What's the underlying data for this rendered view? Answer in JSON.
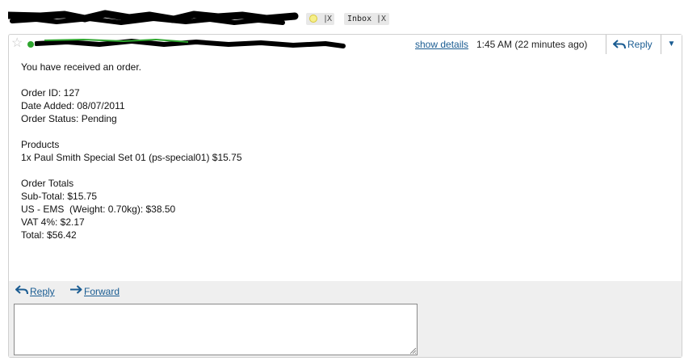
{
  "labels": {
    "d_remove": "X",
    "inbox": "Inbox",
    "inbox_remove": "X"
  },
  "header": {
    "show_details": "show details",
    "time": "1:45 AM (22 minutes ago)",
    "reply_label": "Reply",
    "more_icon": "▼"
  },
  "body": {
    "lines": [
      "You have received an order.",
      "",
      "Order ID: 127",
      "Date Added: 08/07/2011",
      "Order Status: Pending",
      "",
      "Products",
      "1x Paul Smith Special Set 01 (ps-special01) $15.75",
      "",
      "Order Totals",
      "Sub-Total: $15.75",
      "US - EMS  (Weight: 0.70kg): $38.50",
      "VAT 4%: $2.17",
      "Total: $56.42"
    ]
  },
  "footer": {
    "reply": "Reply",
    "forward": "Forward"
  },
  "colors": {
    "link": "#1a5c92",
    "presence": "#2ea52e",
    "label_chip": "#e8e8e8",
    "footer_bg": "#efefef"
  }
}
